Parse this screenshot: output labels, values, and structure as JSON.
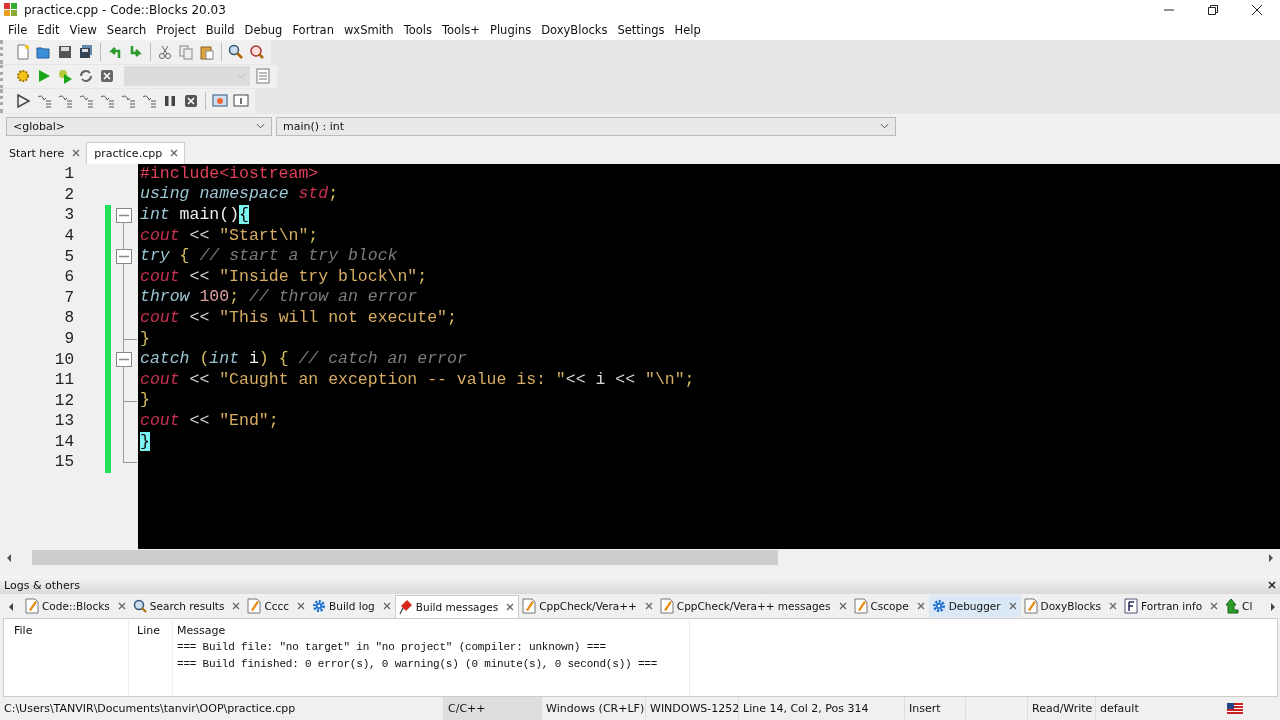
{
  "window": {
    "title": "practice.cpp - Code::Blocks 20.03"
  },
  "menu": [
    "File",
    "Edit",
    "View",
    "Search",
    "Project",
    "Build",
    "Debug",
    "Fortran",
    "wxSmith",
    "Tools",
    "Tools+",
    "Plugins",
    "DoxyBlocks",
    "Settings",
    "Help"
  ],
  "scope_bar": {
    "scope": "<global>",
    "function": "main() : int"
  },
  "editor_tabs": [
    {
      "label": "Start here",
      "selected": false
    },
    {
      "label": "practice.cpp",
      "selected": true
    }
  ],
  "code_lines": [
    {
      "number": "1",
      "changed": false,
      "fold_start": false,
      "fold_end": false,
      "tokens": [
        {
          "text": "#include<iostream>",
          "kind": "preproc"
        }
      ]
    },
    {
      "number": "2",
      "changed": false,
      "fold_start": false,
      "fold_end": false,
      "tokens": [
        {
          "text": "using ",
          "kind": "keyword"
        },
        {
          "text": "namespace ",
          "kind": "keyword"
        },
        {
          "text": "std",
          "kind": "ident"
        },
        {
          "text": ";",
          "kind": "punct"
        }
      ]
    },
    {
      "number": "3",
      "changed": true,
      "fold_start": true,
      "fold_end": false,
      "tokens": [
        {
          "text": "int",
          "kind": "keyword"
        },
        {
          "text": " main()",
          "kind": "plain"
        },
        {
          "text": "{",
          "kind": "match"
        }
      ]
    },
    {
      "number": "4",
      "changed": true,
      "fold_start": false,
      "fold_end": false,
      "tokens": [
        {
          "text": "cout",
          "kind": "ident"
        },
        {
          "text": " << ",
          "kind": "op"
        },
        {
          "text": "\"Start\\n\"",
          "kind": "string"
        },
        {
          "text": ";",
          "kind": "punct"
        }
      ]
    },
    {
      "number": "5",
      "changed": true,
      "fold_start": true,
      "fold_end": false,
      "tokens": [
        {
          "text": "try",
          "kind": "keyword"
        },
        {
          "text": " { ",
          "kind": "punct"
        },
        {
          "text": "// start a try block",
          "kind": "comment"
        }
      ]
    },
    {
      "number": "6",
      "changed": true,
      "fold_start": false,
      "fold_end": false,
      "tokens": [
        {
          "text": "cout",
          "kind": "ident"
        },
        {
          "text": " << ",
          "kind": "op"
        },
        {
          "text": "\"Inside try block\\n\"",
          "kind": "string"
        },
        {
          "text": ";",
          "kind": "punct"
        }
      ]
    },
    {
      "number": "7",
      "changed": true,
      "fold_start": false,
      "fold_end": false,
      "tokens": [
        {
          "text": "throw ",
          "kind": "keyword"
        },
        {
          "text": "100",
          "kind": "number"
        },
        {
          "text": "; ",
          "kind": "punct"
        },
        {
          "text": "// throw an error",
          "kind": "comment"
        }
      ]
    },
    {
      "number": "8",
      "changed": true,
      "fold_start": false,
      "fold_end": false,
      "tokens": [
        {
          "text": "cout",
          "kind": "ident"
        },
        {
          "text": " << ",
          "kind": "op"
        },
        {
          "text": "\"This will not execute\"",
          "kind": "string"
        },
        {
          "text": ";",
          "kind": "punct"
        }
      ]
    },
    {
      "number": "9",
      "changed": true,
      "fold_start": false,
      "fold_end": true,
      "tokens": [
        {
          "text": "}",
          "kind": "punct"
        }
      ]
    },
    {
      "number": "10",
      "changed": true,
      "fold_start": true,
      "fold_end": false,
      "tokens": [
        {
          "text": "catch ",
          "kind": "keyword"
        },
        {
          "text": "(",
          "kind": "punct"
        },
        {
          "text": "int",
          "kind": "keyword"
        },
        {
          "text": " i",
          "kind": "plain"
        },
        {
          "text": ") { ",
          "kind": "punct"
        },
        {
          "text": "// catch an error",
          "kind": "comment"
        }
      ]
    },
    {
      "number": "11",
      "changed": true,
      "fold_start": false,
      "fold_end": false,
      "tokens": [
        {
          "text": "cout",
          "kind": "ident"
        },
        {
          "text": " << ",
          "kind": "op"
        },
        {
          "text": "\"Caught an exception -- value is: \"",
          "kind": "string"
        },
        {
          "text": "<< i << ",
          "kind": "op"
        },
        {
          "text": "\"\\n\"",
          "kind": "string"
        },
        {
          "text": ";",
          "kind": "punct"
        }
      ]
    },
    {
      "number": "12",
      "changed": true,
      "fold_start": false,
      "fold_end": true,
      "tokens": [
        {
          "text": "}",
          "kind": "punct"
        }
      ]
    },
    {
      "number": "13",
      "changed": true,
      "fold_start": false,
      "fold_end": false,
      "tokens": [
        {
          "text": "cout",
          "kind": "ident"
        },
        {
          "text": " << ",
          "kind": "op"
        },
        {
          "text": "\"End\"",
          "kind": "string"
        },
        {
          "text": ";",
          "kind": "punct"
        }
      ]
    },
    {
      "number": "14",
      "changed": true,
      "fold_start": false,
      "fold_end": false,
      "tokens": [
        {
          "text": "}",
          "kind": "match"
        }
      ]
    },
    {
      "number": "15",
      "changed": true,
      "fold_start": false,
      "fold_end": true
    }
  ],
  "logs_panel": {
    "title": "Logs & others",
    "tabs": [
      {
        "label": "Code::Blocks",
        "kind": "note",
        "selected": false,
        "hovered": false
      },
      {
        "label": "Search results",
        "kind": "search",
        "selected": false,
        "hovered": false
      },
      {
        "label": "Cccc",
        "kind": "note",
        "selected": false,
        "hovered": false
      },
      {
        "label": "Build log",
        "kind": "gear",
        "selected": false,
        "hovered": false
      },
      {
        "label": "Build messages",
        "kind": "pin",
        "selected": true,
        "hovered": false
      },
      {
        "label": "CppCheck/Vera++",
        "kind": "note",
        "selected": false,
        "hovered": false
      },
      {
        "label": "CppCheck/Vera++ messages",
        "kind": "note",
        "selected": false,
        "hovered": false
      },
      {
        "label": "Cscope",
        "kind": "note",
        "selected": false,
        "hovered": false
      },
      {
        "label": "Debugger",
        "kind": "gear",
        "selected": false,
        "hovered": true
      },
      {
        "label": "DoxyBlocks",
        "kind": "note",
        "selected": false,
        "hovered": false
      },
      {
        "label": "Fortran info",
        "kind": "doc",
        "selected": false,
        "hovered": false
      },
      {
        "label": "Cl",
        "kind": "arrow",
        "selected": false,
        "hovered": false
      }
    ],
    "columns": [
      "File",
      "Line",
      "Message"
    ],
    "rows": [
      {
        "message": "=== Build file: \"no target\" in \"no project\" (compiler: unknown) ==="
      },
      {
        "message": "=== Build finished: 0 error(s), 0 warning(s) (0 minute(s), 0 second(s)) ==="
      }
    ]
  },
  "status_bar": {
    "path": "C:\\Users\\TANVIR\\Documents\\tanvir\\OOP\\practice.cpp",
    "language": "C/C++",
    "line_endings": "Windows (CR+LF)",
    "encoding": "WINDOWS-1252",
    "position": "Line 14, Col 2, Pos 314",
    "mode": "Insert",
    "access": "Read/Write",
    "profile": "default"
  }
}
